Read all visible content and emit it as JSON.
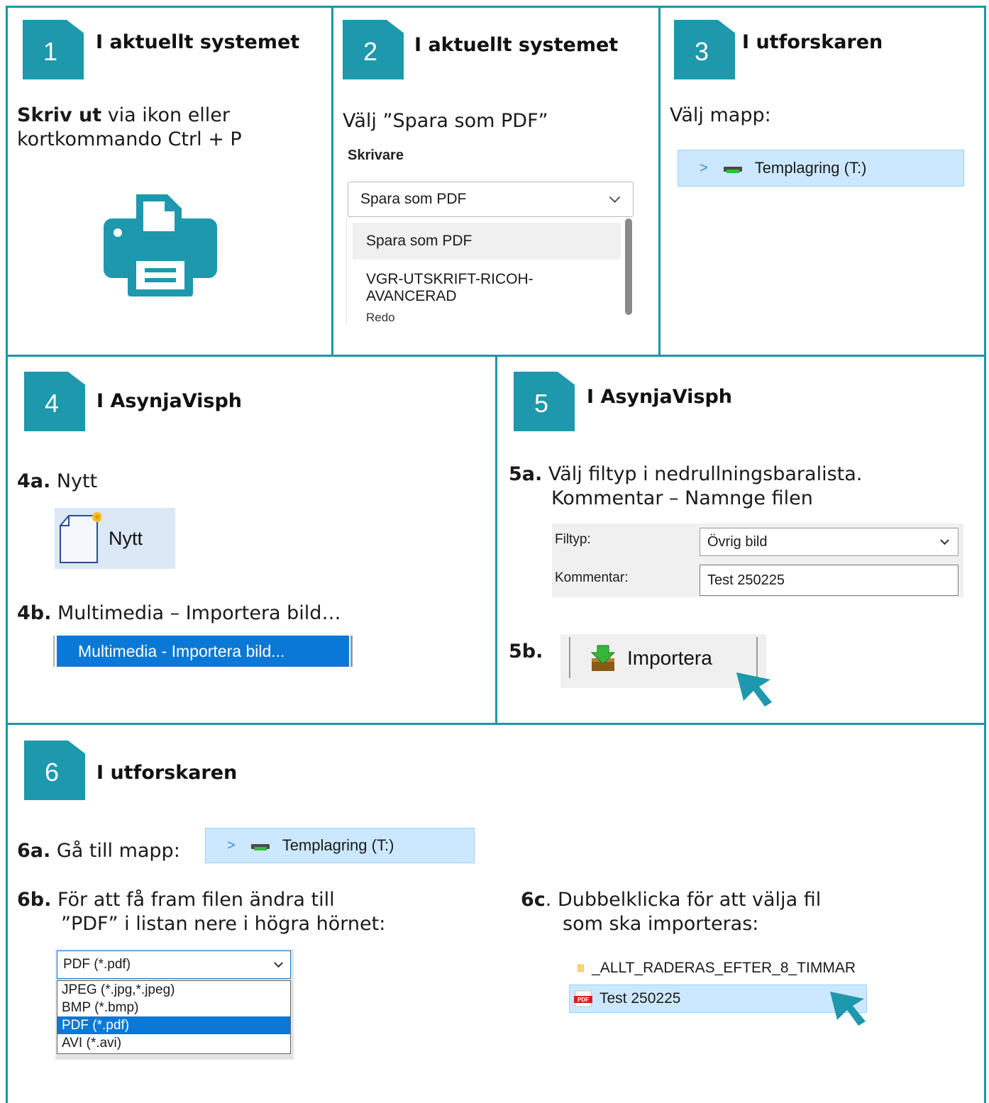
{
  "steps": {
    "s1": {
      "num": "1",
      "heading": "I aktuellt systemet",
      "bold": "Skriv ut",
      "text1": " via ikon eller",
      "text2": "kortkommando Ctrl + P"
    },
    "s2": {
      "num": "2",
      "heading": "I aktuellt systemet",
      "text": "Välj ”Spara som PDF”",
      "printer_label": "Skrivare",
      "selected": "Spara som PDF",
      "options": [
        {
          "label": "Spara som PDF"
        },
        {
          "label": "VGR-UTSKRIFT-RICOH-AVANCERAD",
          "sub": "Redo"
        }
      ]
    },
    "s3": {
      "num": "3",
      "heading": "I utforskaren",
      "text": "Välj mapp:",
      "folder": "Templagring (T:)"
    },
    "s4": {
      "num": "4",
      "heading": "I AsynjaVisph",
      "a_label": "4a.",
      "a_text": " Nytt",
      "new_button": "Nytt",
      "b_label": "4b.",
      "b_text": " Multimedia – Importera bild…",
      "menu_item": "Multimedia - Importera bild..."
    },
    "s5": {
      "num": "5",
      "heading": "I AsynjaVisph",
      "a_label": "5a.",
      "a_text1": " Välj filtyp i nedrullningsbaralista.",
      "a_text2": "Kommentar – Namnge filen",
      "filetype_label": "Filtyp:",
      "filetype_value": "Övrig bild",
      "comment_label": "Kommentar:",
      "comment_value": "Test 250225",
      "b_label": "5b.",
      "import_button": "Importera"
    },
    "s6": {
      "num": "6",
      "heading": "I utforskaren",
      "a_label": "6a.",
      "a_text": " Gå till mapp:",
      "folder": "Templagring (T:)",
      "b_label": "6b.",
      "b_text1": " För att få fram filen ändra till",
      "b_text2": "”PDF” i listan nere i högra hörnet:",
      "filter_selected": "PDF (*.pdf)",
      "filter_options": [
        "JPEG (*.jpg,*.jpeg)",
        "BMP (*.bmp)",
        "PDF (*.pdf)",
        "AVI (*.avi)"
      ],
      "c_label": "6c",
      "c_text1": ". Dubbelklicka för att välja fil",
      "c_text2": "som ska importeras:",
      "files": [
        "_ALLT_RADERAS_EFTER_8_TIMMAR",
        "Test 250225"
      ]
    }
  },
  "colors": {
    "accent": "#1b96aa",
    "selection": "#cce8ff",
    "menu_blue": "#0a78d7"
  }
}
